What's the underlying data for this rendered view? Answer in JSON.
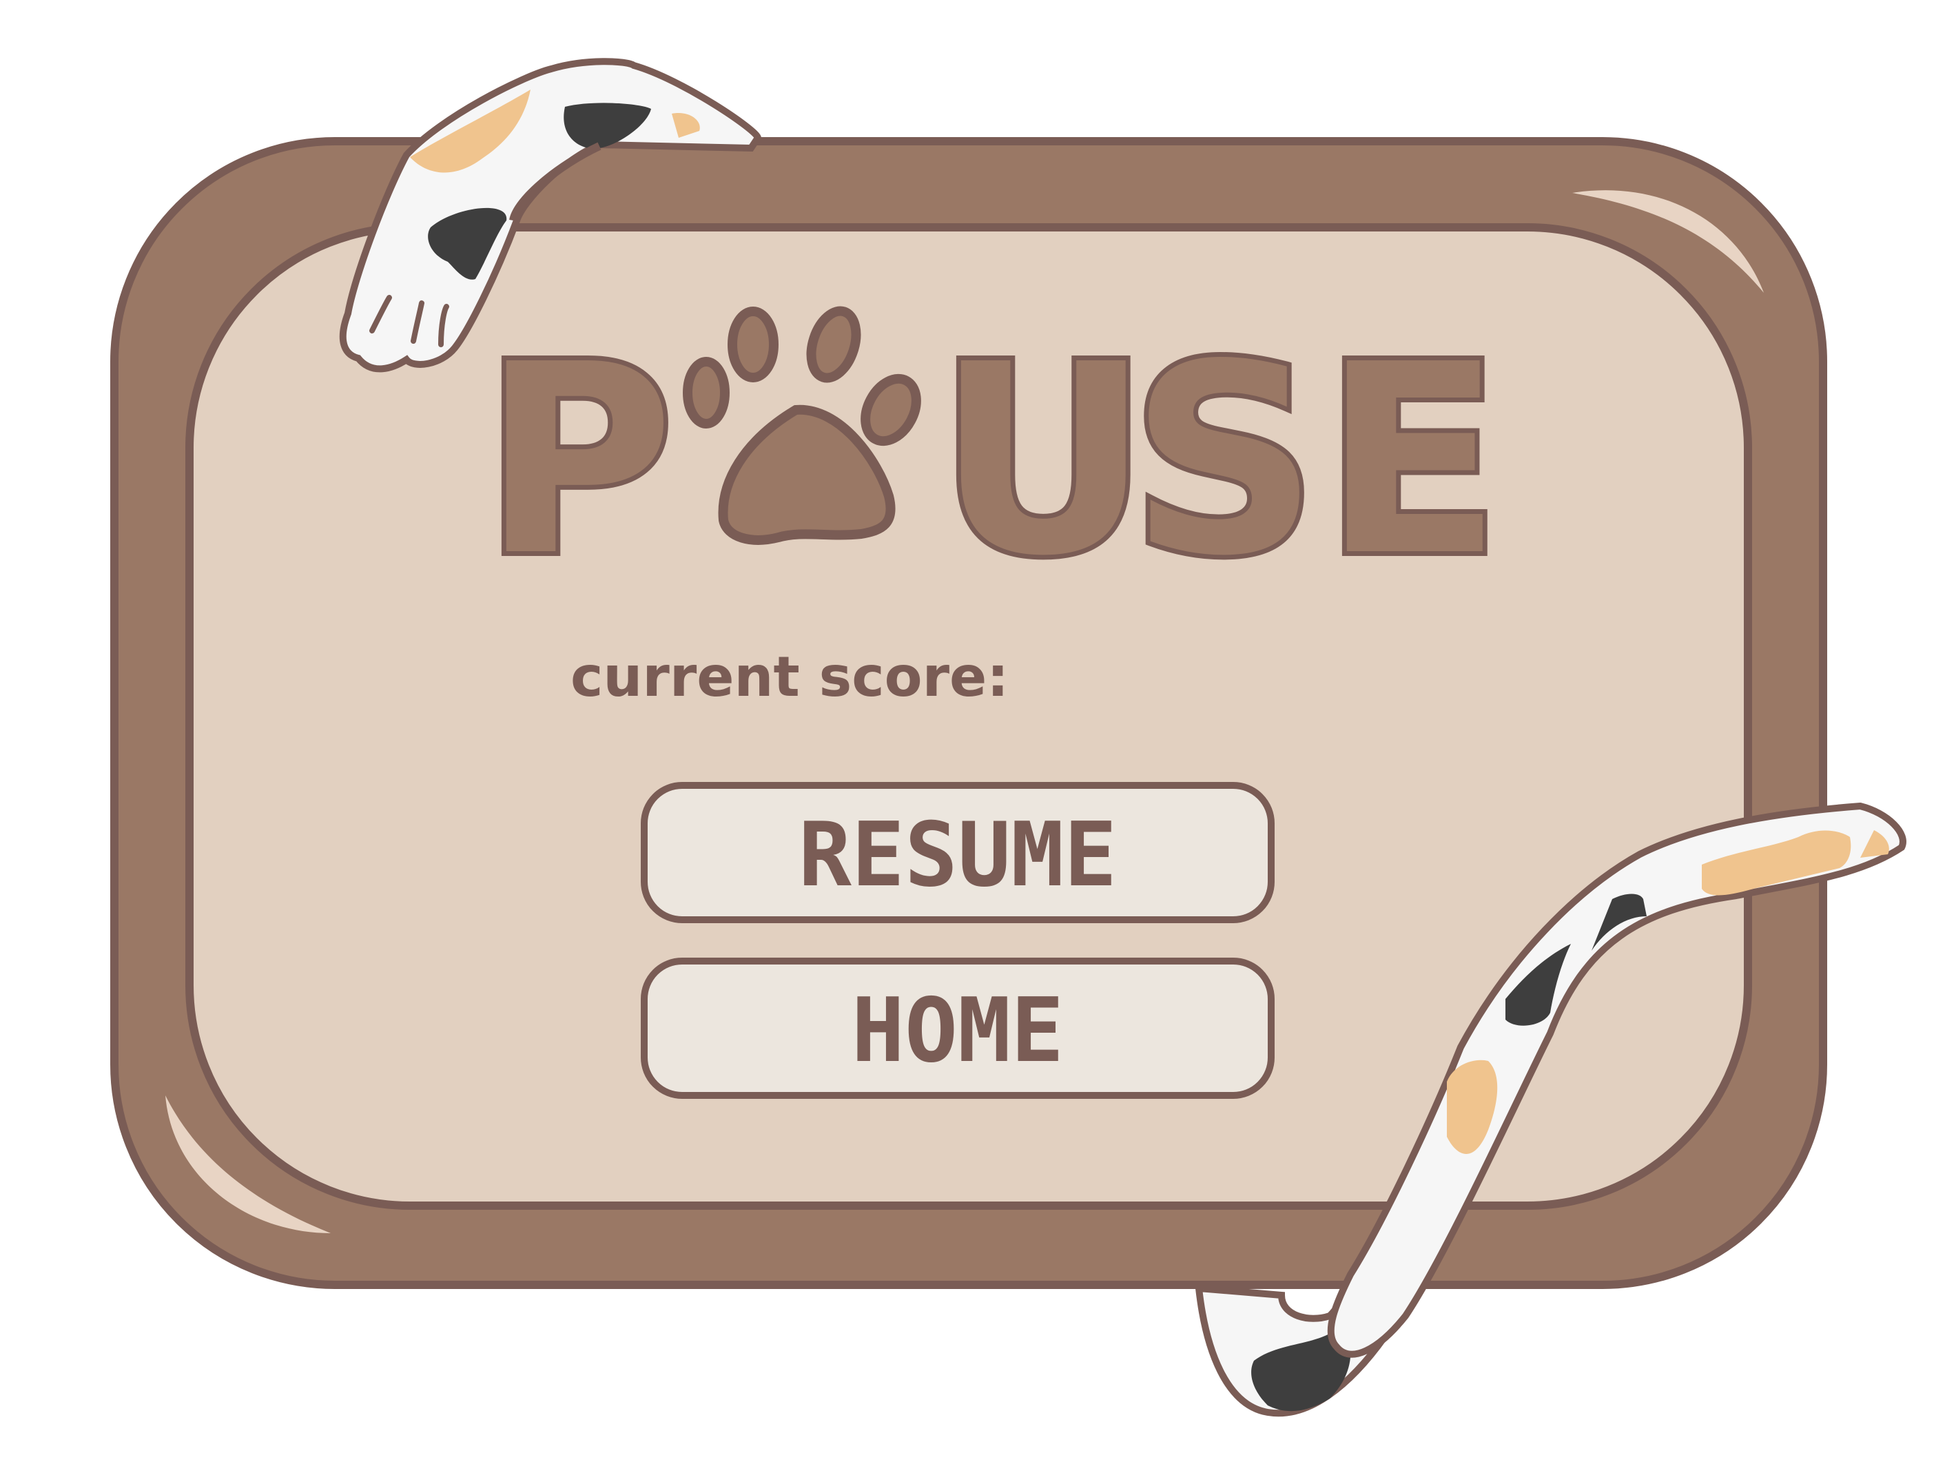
{
  "pause_menu": {
    "title_letters": [
      "P",
      "U",
      "S",
      "E"
    ],
    "paw_icon": "paw-print-icon",
    "score_label": "current score:",
    "buttons": {
      "resume_label": "RESUME",
      "home_label": "HOME"
    }
  },
  "colors": {
    "frame_outer": "#9a7865",
    "frame_outline": "#7a5c55",
    "panel_inner": "#e2d0c0",
    "button_fill": "#ece6de",
    "highlight": "#e8d4c4",
    "cat_white": "#f6f6f6",
    "cat_orange": "#f0c48e",
    "cat_black": "#3e3e3e"
  },
  "decorations": {
    "cat_paw": "cat-paw-icon",
    "cat_tail": "cat-tail-icon"
  }
}
